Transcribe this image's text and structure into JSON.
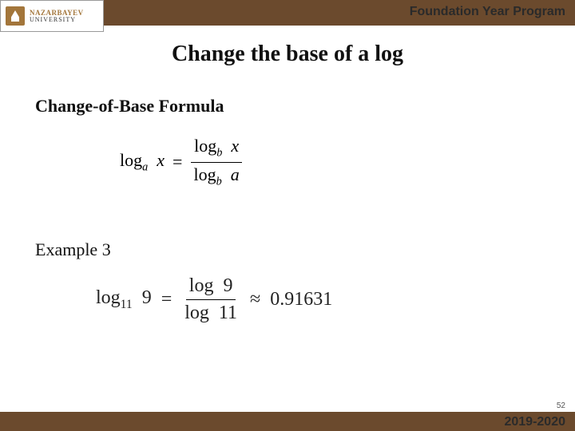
{
  "header": {
    "logo_line1": "NAZARBAYEV",
    "logo_line2": "UNIVERSITY",
    "program": "Foundation Year Program"
  },
  "slide": {
    "title": "Change the base of a log",
    "section_heading": "Change-of-Base Formula",
    "formula": {
      "lhs_func": "log",
      "lhs_base": "a",
      "lhs_arg": "x",
      "eq": "=",
      "num_func": "log",
      "num_base": "b",
      "num_arg": "x",
      "den_func": "log",
      "den_base": "b",
      "den_arg": "a"
    },
    "example_heading": "Example 3",
    "example": {
      "lhs_func": "log",
      "lhs_base": "11",
      "lhs_arg": "9",
      "eq": "=",
      "num_func": "log",
      "num_arg": "9",
      "den_func": "log",
      "den_arg": "11",
      "approx": "≈",
      "result": "0.91631"
    }
  },
  "footer": {
    "year": "2019-2020",
    "page": "52"
  }
}
